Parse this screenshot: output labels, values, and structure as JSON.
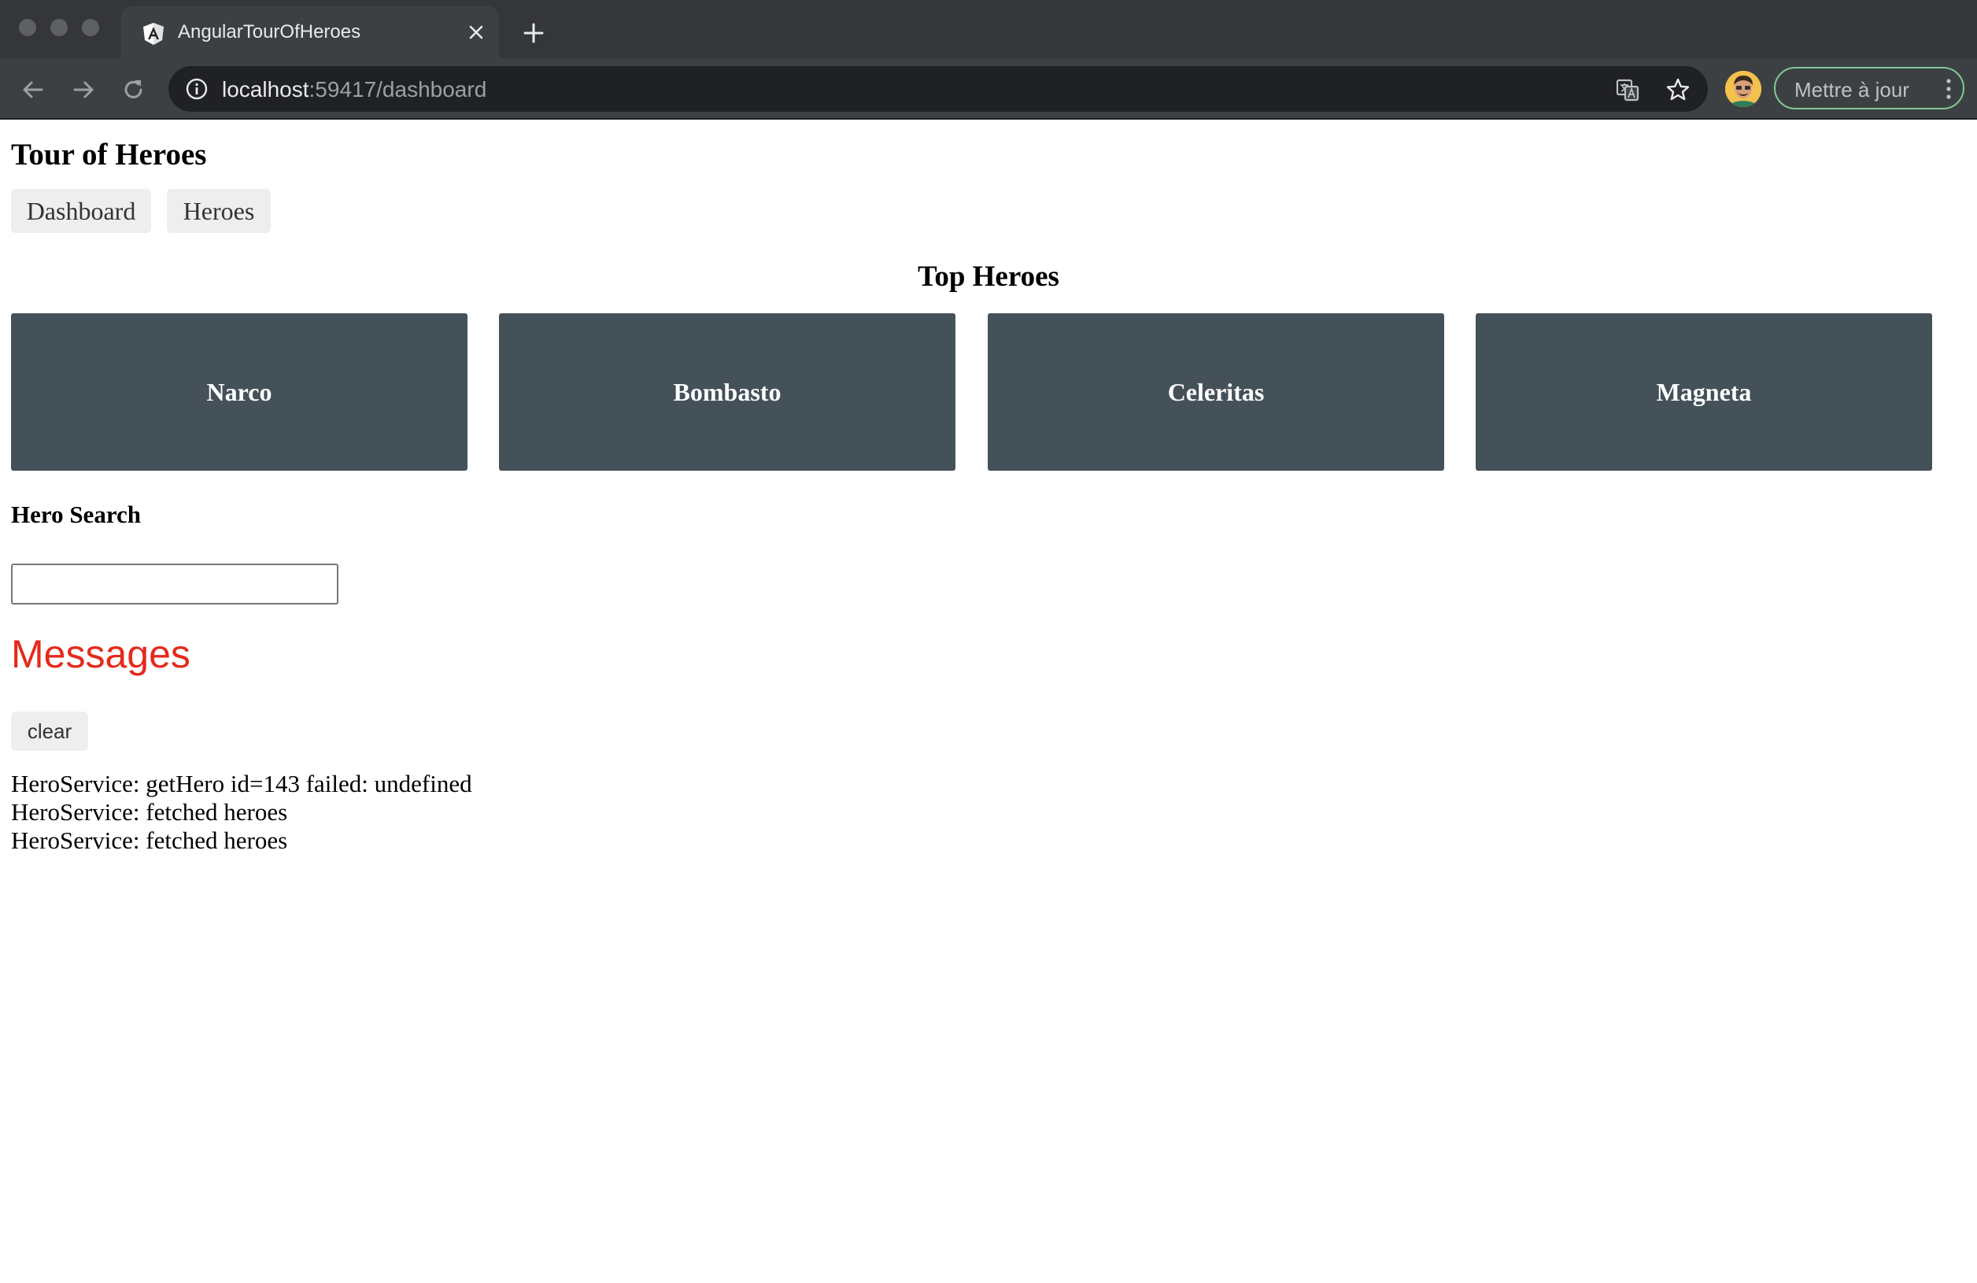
{
  "browser": {
    "tab": {
      "title": "AngularTourOfHeroes",
      "favicon": "angular-logo"
    },
    "address": {
      "host": "localhost",
      "rest": ":59417/dashboard"
    },
    "update_button_label": "Mettre à jour",
    "icons": {
      "back": "arrow-left",
      "forward": "arrow-right",
      "reload": "reload",
      "info": "info-circle",
      "translate": "translate",
      "bookmark": "star",
      "menu": "vertical-dots",
      "close": "x",
      "new_tab": "plus"
    }
  },
  "app": {
    "title": "Tour of Heroes",
    "nav": [
      {
        "label": "Dashboard"
      },
      {
        "label": "Heroes"
      }
    ]
  },
  "dashboard": {
    "title": "Top Heroes",
    "heroes": [
      {
        "name": "Narco"
      },
      {
        "name": "Bombasto"
      },
      {
        "name": "Celeritas"
      },
      {
        "name": "Magneta"
      }
    ]
  },
  "search": {
    "title": "Hero Search",
    "value": ""
  },
  "messages": {
    "title": "Messages",
    "clear_label": "clear",
    "items": [
      "HeroService: getHero id=143 failed: undefined",
      "HeroService: fetched heroes",
      "HeroService: fetched heroes"
    ]
  },
  "colors": {
    "hero_card": "#455159",
    "messages_title": "#e42a1d",
    "update_border": "#81c995"
  }
}
